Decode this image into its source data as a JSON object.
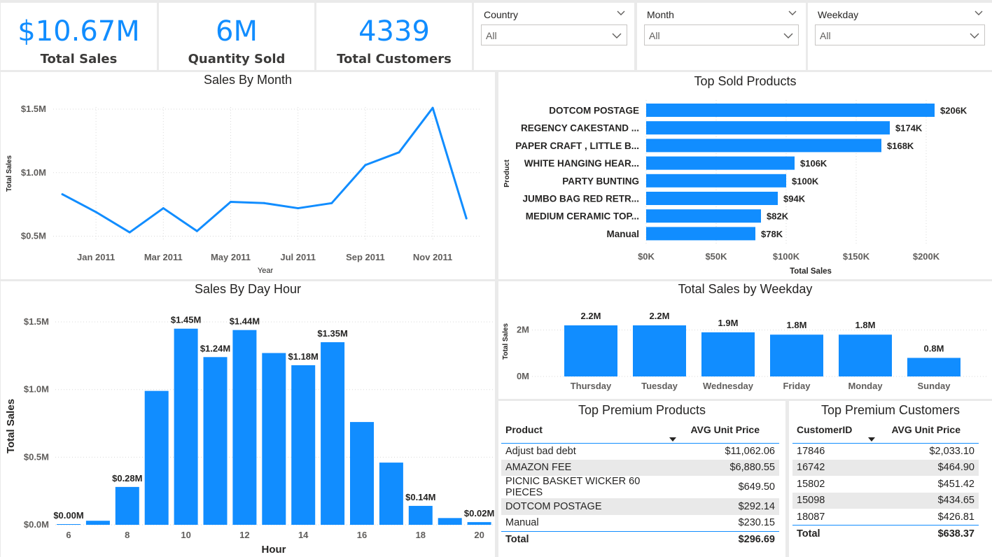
{
  "kpis": [
    {
      "value": "$10.67M",
      "label": "Total Sales"
    },
    {
      "value": "6M",
      "label": "Quantity Sold"
    },
    {
      "value": "4339",
      "label": "Total Customers"
    }
  ],
  "slicers": [
    {
      "title": "Country",
      "value": "All"
    },
    {
      "title": "Month",
      "value": "All"
    },
    {
      "title": "Weekday",
      "value": "All"
    }
  ],
  "colors": {
    "accent": "#118DFF",
    "alt_row": "#e9e9e9"
  },
  "sales_by_month": {
    "title": "Sales By Month",
    "xlabel": "Year",
    "ylabel": "Total Sales",
    "tick_labels": [
      "Jan 2011",
      "Mar 2011",
      "May 2011",
      "Jul 2011",
      "Sep 2011",
      "Nov 2011"
    ],
    "y_tick_labels": [
      "$1.5M",
      "$1.0M",
      "$0.5M"
    ]
  },
  "top_sold_products": {
    "title": "Top Sold Products",
    "xlabel": "Total Sales",
    "ylabel": "Product",
    "x_tick_labels": [
      "$0K",
      "$50K",
      "$100K",
      "$150K",
      "$200K"
    ],
    "data_labels": [
      "$206K",
      "$174K",
      "$168K",
      "$106K",
      "$100K",
      "$94K",
      "$82K",
      "$78K"
    ]
  },
  "sales_by_day_hour": {
    "title": "Sales By Day Hour",
    "xlabel": "Hour",
    "ylabel": "Total Sales",
    "x_tick_labels": [
      "6",
      "8",
      "10",
      "12",
      "14",
      "16",
      "18",
      "20"
    ],
    "y_tick_labels": [
      "$1.5M",
      "$1.0M",
      "$0.5M",
      "$0.0M"
    ]
  },
  "sales_by_weekday": {
    "title": "Total Sales by Weekday",
    "ylabel": "Total Sales",
    "y_tick_labels": [
      "2M",
      "0M"
    ],
    "data_labels": [
      "2.2M",
      "2.2M",
      "1.9M",
      "1.8M",
      "1.8M",
      "0.8M"
    ]
  },
  "chart_data": [
    {
      "type": "line",
      "title": "Sales By Month",
      "xlabel": "Year",
      "ylabel": "Total Sales",
      "x": [
        "Dec 2010",
        "Jan 2011",
        "Feb 2011",
        "Mar 2011",
        "Apr 2011",
        "May 2011",
        "Jun 2011",
        "Jul 2011",
        "Aug 2011",
        "Sep 2011",
        "Oct 2011",
        "Nov 2011",
        "Dec 2011"
      ],
      "series": [
        {
          "values": [
            0.83,
            0.69,
            0.53,
            0.72,
            0.54,
            0.77,
            0.76,
            0.72,
            0.76,
            1.06,
            1.16,
            1.51,
            0.64
          ]
        }
      ],
      "ylim": [
        0.5,
        1.5
      ],
      "grid": true
    },
    {
      "type": "bar",
      "orientation": "horizontal",
      "title": "Top Sold Products",
      "xlabel": "Total Sales",
      "ylabel": "Product",
      "categories": [
        "DOTCOM POSTAGE",
        "REGENCY CAKESTAND ...",
        "PAPER CRAFT , LITTLE B...",
        "WHITE HANGING HEAR...",
        "PARTY BUNTING",
        "JUMBO BAG RED RETR...",
        "MEDIUM CERAMIC TOP...",
        "Manual"
      ],
      "values": [
        206,
        174,
        168,
        106,
        100,
        94,
        82,
        78
      ],
      "xlim": [
        0,
        200
      ],
      "grid": true
    },
    {
      "type": "bar",
      "title": "Sales By Day Hour",
      "xlabel": "Hour",
      "ylabel": "Total Sales",
      "categories": [
        6,
        7,
        8,
        9,
        10,
        11,
        12,
        13,
        14,
        15,
        16,
        17,
        18,
        19,
        20
      ],
      "values": [
        0.004,
        0.03,
        0.28,
        0.99,
        1.45,
        1.24,
        1.44,
        1.27,
        1.18,
        1.35,
        0.76,
        0.46,
        0.14,
        0.05,
        0.02
      ],
      "data_labels": {
        "6": "$0.00M",
        "8": "$0.28M",
        "10": "$1.45M",
        "11": "$1.24M",
        "12": "$1.44M",
        "14": "$1.18M",
        "15": "$1.35M",
        "18": "$0.14M",
        "20": "$0.02M"
      },
      "ylim": [
        0,
        1.5
      ],
      "grid": true
    },
    {
      "type": "bar",
      "title": "Total Sales by Weekday",
      "ylabel": "Total Sales",
      "categories": [
        "Thursday",
        "Tuesday",
        "Wednesday",
        "Friday",
        "Monday",
        "Sunday"
      ],
      "values": [
        2.2,
        2.2,
        1.9,
        1.8,
        1.8,
        0.8
      ],
      "ylim": [
        0,
        2
      ],
      "grid": true
    },
    {
      "type": "table",
      "title": "Top Premium Products",
      "columns": [
        "Product",
        "AVG Unit Price"
      ],
      "rows": [
        [
          "Adjust bad debt",
          "$11,062.06"
        ],
        [
          "AMAZON FEE",
          "$6,880.55"
        ],
        [
          "PICNIC BASKET WICKER 60 PIECES",
          "$649.50"
        ],
        [
          "DOTCOM POSTAGE",
          "$292.14"
        ],
        [
          "Manual",
          "$230.15"
        ]
      ],
      "total": [
        "Total",
        "$296.69"
      ]
    },
    {
      "type": "table",
      "title": "Top Premium Customers",
      "columns": [
        "CustomerID",
        "AVG Unit Price"
      ],
      "rows": [
        [
          "17846",
          "$2,033.10"
        ],
        [
          "16742",
          "$464.90"
        ],
        [
          "15802",
          "$451.42"
        ],
        [
          "15098",
          "$434.65"
        ],
        [
          "18087",
          "$426.81"
        ]
      ],
      "total": [
        "Total",
        "$638.37"
      ]
    }
  ]
}
